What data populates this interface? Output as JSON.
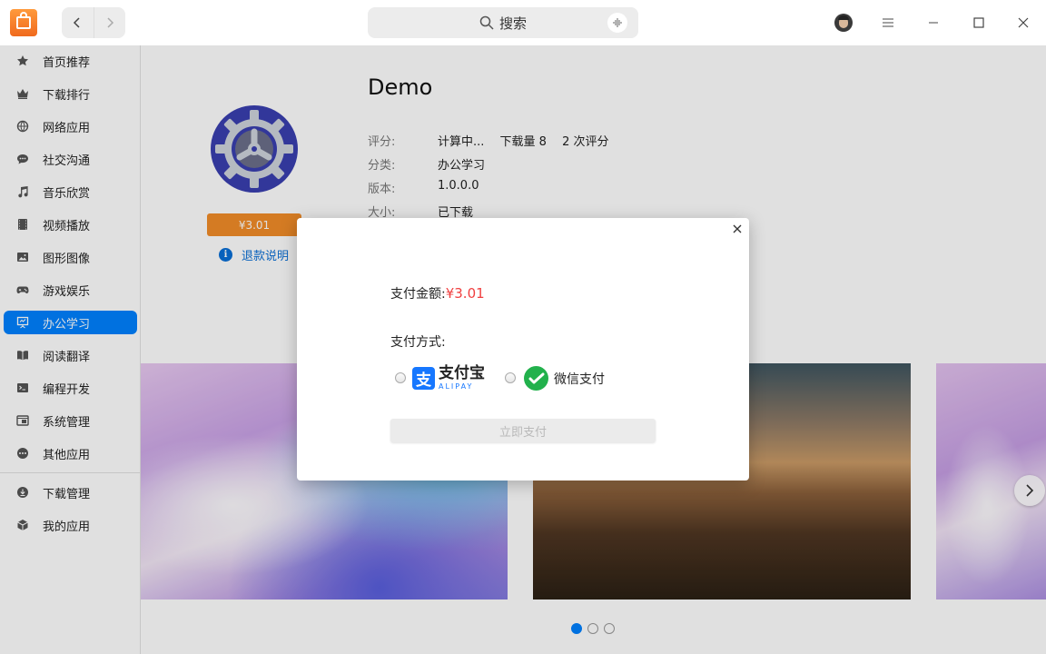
{
  "window": {
    "search": {
      "label": "搜索"
    }
  },
  "sidebar": {
    "items": [
      {
        "label": "首页推荐",
        "icon": "star-icon"
      },
      {
        "label": "下载排行",
        "icon": "crown-icon"
      },
      {
        "label": "网络应用",
        "icon": "globe-icon"
      },
      {
        "label": "社交沟通",
        "icon": "chat-bubble-icon"
      },
      {
        "label": "音乐欣赏",
        "icon": "music-note-icon"
      },
      {
        "label": "视频播放",
        "icon": "film-icon"
      },
      {
        "label": "图形图像",
        "icon": "image-icon"
      },
      {
        "label": "游戏娱乐",
        "icon": "gamepad-icon"
      },
      {
        "label": "办公学习",
        "icon": "presentation-icon",
        "active": true
      },
      {
        "label": "阅读翻译",
        "icon": "book-icon"
      },
      {
        "label": "编程开发",
        "icon": "terminal-icon"
      },
      {
        "label": "系统管理",
        "icon": "system-icon"
      },
      {
        "label": "其他应用",
        "icon": "more-icon"
      }
    ],
    "bottom_items": [
      {
        "label": "下载管理",
        "icon": "download-icon"
      },
      {
        "label": "我的应用",
        "icon": "box-icon"
      }
    ],
    "active_color": "#0081ff"
  },
  "app": {
    "name": "Demo",
    "price": "¥3.01",
    "refund_label": "退款说明",
    "meta": {
      "rating_key": "评分:",
      "rating_value": "计算中...",
      "downloads": "下载量 8",
      "rating_count": "2 次评分",
      "category_key": "分类:",
      "category_value": "办公学习",
      "version_key": "版本:",
      "version_value": "1.0.0.0",
      "size_key": "大小:",
      "size_value": "已下载"
    }
  },
  "carousel": {
    "page_count": 3,
    "active_index": 0
  },
  "dialog": {
    "amount_label": "支付金额:",
    "amount_value": "¥3.01",
    "method_label": "支付方式:",
    "alipay_cn": "支付宝",
    "alipay_en": "ALIPAY",
    "alipay_logo_char": "支",
    "wechat_label": "微信支付",
    "pay_button": "立即支付"
  },
  "colors": {
    "price_button": "#f28c28",
    "alipay_blue": "#1677ff",
    "wechat_green": "#22b14c",
    "amount_red": "#f04040"
  }
}
